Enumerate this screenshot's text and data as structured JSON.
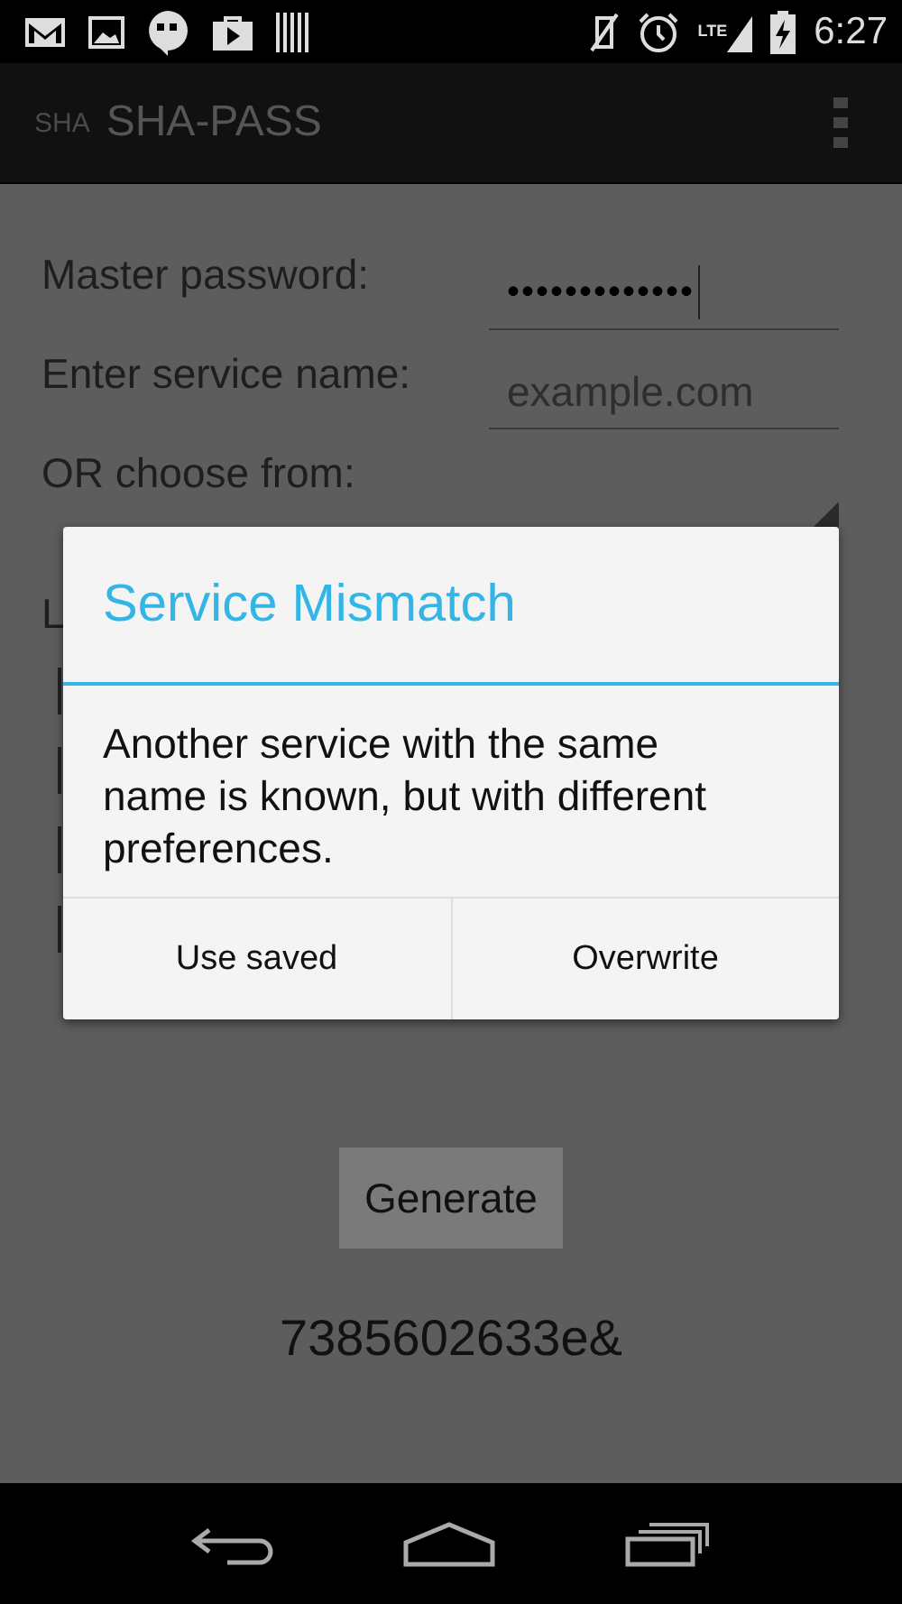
{
  "status_bar": {
    "network": "LTE",
    "time": "6:27"
  },
  "action_bar": {
    "logo": "SHA",
    "title": "SHA-PASS"
  },
  "form": {
    "password_label": "Master password:",
    "password_value": "•••••••••••••",
    "service_label": "Enter service name:",
    "service_placeholder": "example.com",
    "choose_label": "OR choose from:",
    "partial_label": "L",
    "generate_button": "Generate",
    "result": "7385602633e&"
  },
  "dialog": {
    "title": "Service Mismatch",
    "message": "Another service with the same name is known, but with different preferences.",
    "buttons": [
      "Use saved",
      "Overwrite"
    ]
  }
}
